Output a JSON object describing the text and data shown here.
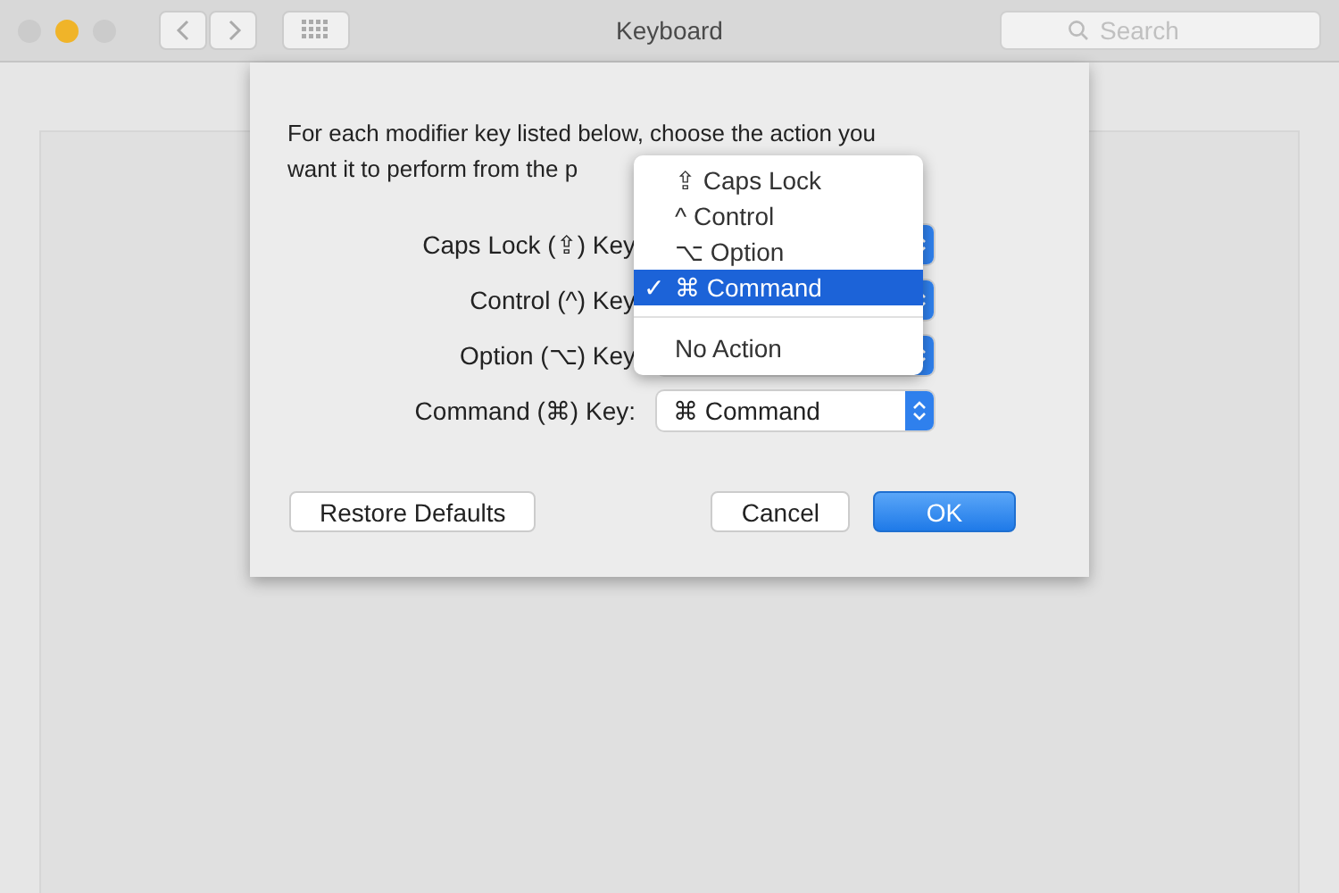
{
  "window": {
    "title": "Keyboard",
    "search": {
      "placeholder": "Search"
    }
  },
  "sheet": {
    "description": [
      "For each modifier key listed below, choose the action you",
      "want it to perform from the p"
    ],
    "rows": [
      {
        "label": "Caps Lock (⇪) Key",
        "value": ""
      },
      {
        "label": "Control (^) Key",
        "value": ""
      },
      {
        "label": "Option (⌥) Key",
        "value": ""
      },
      {
        "label": "Command (⌘) Key:",
        "value": "⌘ Command"
      }
    ],
    "menu": [
      {
        "kind": "item",
        "label": "⇪ Caps Lock",
        "selected": false
      },
      {
        "kind": "item",
        "label": "^ Control",
        "selected": false
      },
      {
        "kind": "item",
        "label": "⌥ Option",
        "selected": false
      },
      {
        "kind": "item",
        "label": "⌘ Command",
        "selected": true,
        "check": "✓"
      },
      {
        "kind": "separator"
      },
      {
        "kind": "item",
        "label": "No Action",
        "selected": false
      }
    ],
    "buttons": [
      {
        "kind": "plain",
        "label": "Restore Defaults"
      },
      {
        "kind": "plain",
        "label": "Cancel"
      },
      {
        "kind": "default",
        "label": "OK"
      }
    ]
  }
}
